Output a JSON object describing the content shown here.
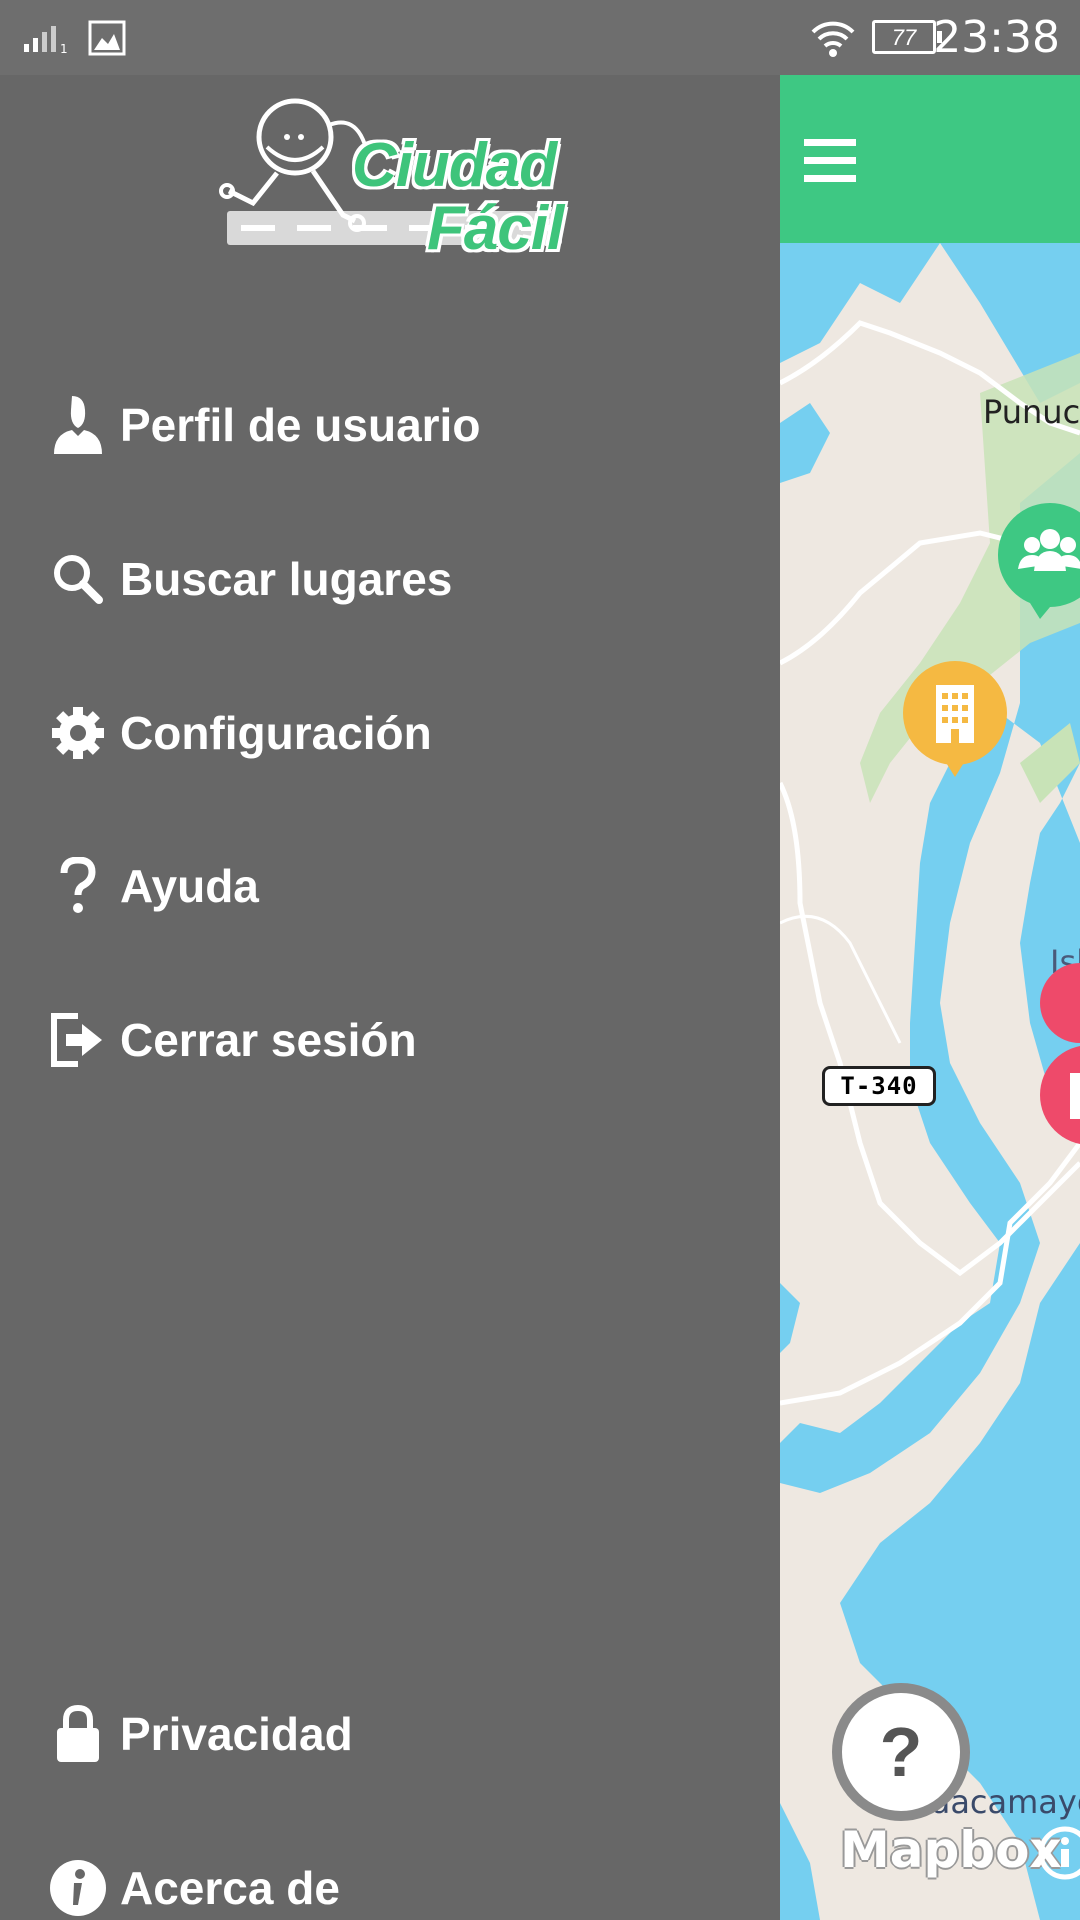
{
  "status_bar": {
    "time": "23:38",
    "battery": "77",
    "sim_indicator": "1"
  },
  "logo": {
    "line1": "Ciudad",
    "line2": "Fácil"
  },
  "menu": {
    "profile": "Perfil de usuario",
    "search": "Buscar lugares",
    "settings": "Configuración",
    "help": "Ayuda",
    "logout": "Cerrar sesión",
    "privacy": "Privacidad",
    "about": "Acerca de"
  },
  "map": {
    "place_punuc": "Punuc",
    "place_isl": "Isl",
    "place_dacamay": "dacamayo",
    "road_shield": "T-340",
    "help_button": "?",
    "attribution": "Mapbox",
    "colors": {
      "water": "#75cff0",
      "land": "#eee8e1",
      "park": "#c8e3b7",
      "appbar": "#3ec883",
      "marker_green": "#3ec883",
      "marker_yellow": "#f5b942",
      "marker_red": "#ee4a6a"
    }
  }
}
